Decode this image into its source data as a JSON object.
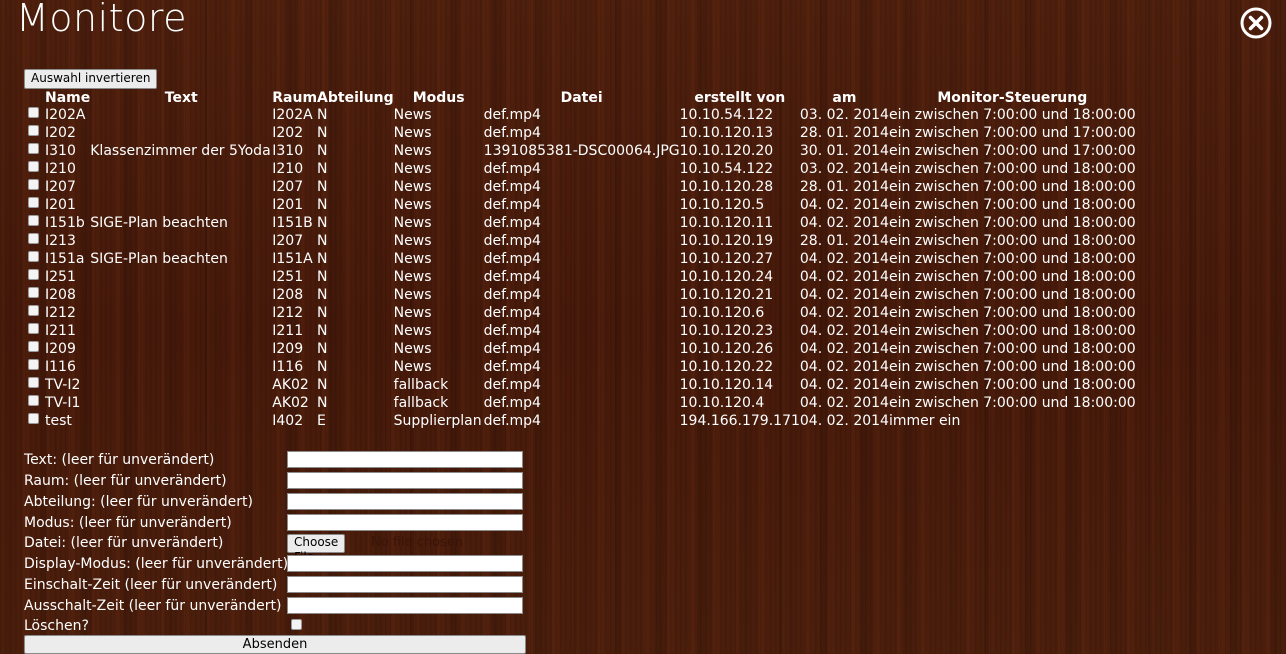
{
  "title": "Monitore",
  "close_icon": "close-circle-icon",
  "invert_button": "Auswahl invertieren",
  "columns": [
    "Name",
    "Text",
    "Raum",
    "Abteilung",
    "Modus",
    "Datei",
    "erstellt von",
    "am",
    "Monitor-Steuerung"
  ],
  "rows": [
    {
      "name": "I202A",
      "text": "",
      "raum": "I202A",
      "abteilung": "N",
      "modus": "News",
      "datei": "def.mp4",
      "ersteller": "10.10.54.122",
      "am": "03. 02. 2014",
      "steuerung": "ein zwischen 7:00:00 und 18:00:00"
    },
    {
      "name": "I202",
      "text": "",
      "raum": "I202",
      "abteilung": "N",
      "modus": "News",
      "datei": "def.mp4",
      "ersteller": "10.10.120.13",
      "am": "28. 01. 2014",
      "steuerung": "ein zwischen 7:00:00 und 17:00:00"
    },
    {
      "name": "I310",
      "text": "Klassenzimmer der 5Yoda",
      "raum": "I310",
      "abteilung": "N",
      "modus": "News",
      "datei": "1391085381-DSC00064.JPG",
      "ersteller": "10.10.120.20",
      "am": "30. 01. 2014",
      "steuerung": "ein zwischen 7:00:00 und 17:00:00"
    },
    {
      "name": "I210",
      "text": "",
      "raum": "I210",
      "abteilung": "N",
      "modus": "News",
      "datei": "def.mp4",
      "ersteller": "10.10.54.122",
      "am": "03. 02. 2014",
      "steuerung": "ein zwischen 7:00:00 und 18:00:00"
    },
    {
      "name": "I207",
      "text": "",
      "raum": "I207",
      "abteilung": "N",
      "modus": "News",
      "datei": "def.mp4",
      "ersteller": "10.10.120.28",
      "am": "28. 01. 2014",
      "steuerung": "ein zwischen 7:00:00 und 18:00:00"
    },
    {
      "name": "I201",
      "text": "",
      "raum": "I201",
      "abteilung": "N",
      "modus": "News",
      "datei": "def.mp4",
      "ersteller": "10.10.120.5",
      "am": "04. 02. 2014",
      "steuerung": "ein zwischen 7:00:00 und 18:00:00"
    },
    {
      "name": "I151b",
      "text": "SIGE-Plan beachten",
      "raum": "I151B",
      "abteilung": "N",
      "modus": "News",
      "datei": "def.mp4",
      "ersteller": "10.10.120.11",
      "am": "04. 02. 2014",
      "steuerung": "ein zwischen 7:00:00 und 18:00:00"
    },
    {
      "name": "I213",
      "text": "",
      "raum": "I207",
      "abteilung": "N",
      "modus": "News",
      "datei": "def.mp4",
      "ersteller": "10.10.120.19",
      "am": "28. 01. 2014",
      "steuerung": "ein zwischen 7:00:00 und 18:00:00"
    },
    {
      "name": "I151a",
      "text": "SIGE-Plan beachten",
      "raum": "I151A",
      "abteilung": "N",
      "modus": "News",
      "datei": "def.mp4",
      "ersteller": "10.10.120.27",
      "am": "04. 02. 2014",
      "steuerung": "ein zwischen 7:00:00 und 18:00:00"
    },
    {
      "name": "I251",
      "text": "",
      "raum": "I251",
      "abteilung": "N",
      "modus": "News",
      "datei": "def.mp4",
      "ersteller": "10.10.120.24",
      "am": "04. 02. 2014",
      "steuerung": "ein zwischen 7:00:00 und 18:00:00"
    },
    {
      "name": "I208",
      "text": "",
      "raum": "I208",
      "abteilung": "N",
      "modus": "News",
      "datei": "def.mp4",
      "ersteller": "10.10.120.21",
      "am": "04. 02. 2014",
      "steuerung": "ein zwischen 7:00:00 und 18:00:00"
    },
    {
      "name": "I212",
      "text": "",
      "raum": "I212",
      "abteilung": "N",
      "modus": "News",
      "datei": "def.mp4",
      "ersteller": "10.10.120.6",
      "am": "04. 02. 2014",
      "steuerung": "ein zwischen 7:00:00 und 18:00:00"
    },
    {
      "name": "I211",
      "text": "",
      "raum": "I211",
      "abteilung": "N",
      "modus": "News",
      "datei": "def.mp4",
      "ersteller": "10.10.120.23",
      "am": "04. 02. 2014",
      "steuerung": "ein zwischen 7:00:00 und 18:00:00"
    },
    {
      "name": "I209",
      "text": "",
      "raum": "I209",
      "abteilung": "N",
      "modus": "News",
      "datei": "def.mp4",
      "ersteller": "10.10.120.26",
      "am": "04. 02. 2014",
      "steuerung": "ein zwischen 7:00:00 und 18:00:00"
    },
    {
      "name": "I116",
      "text": "",
      "raum": "I116",
      "abteilung": "N",
      "modus": "News",
      "datei": "def.mp4",
      "ersteller": "10.10.120.22",
      "am": "04. 02. 2014",
      "steuerung": "ein zwischen 7:00:00 und 18:00:00"
    },
    {
      "name": "TV-I2",
      "text": "",
      "raum": "AK02",
      "abteilung": "N",
      "modus": "fallback",
      "datei": "def.mp4",
      "ersteller": "10.10.120.14",
      "am": "04. 02. 2014",
      "steuerung": "ein zwischen 7:00:00 und 18:00:00"
    },
    {
      "name": "TV-I1",
      "text": "",
      "raum": "AK02",
      "abteilung": "N",
      "modus": "fallback",
      "datei": "def.mp4",
      "ersteller": "10.10.120.4",
      "am": "04. 02. 2014",
      "steuerung": "ein zwischen 7:00:00 und 18:00:00"
    },
    {
      "name": "test",
      "text": "",
      "raum": "I402",
      "abteilung": "E",
      "modus": "Supplierplan",
      "datei": "def.mp4",
      "ersteller": "194.166.179.171",
      "am": "04. 02. 2014",
      "steuerung": "immer ein"
    }
  ],
  "form": {
    "text_label": "Text: (leer für unverändert)",
    "raum_label": "Raum: (leer für unverändert)",
    "abteilung_label": "Abteilung: (leer für unverändert)",
    "modus_label": "Modus: (leer für unverändert)",
    "datei_label": "Datei: (leer für unverändert)",
    "choose_file": "Choose File",
    "no_file": "No file chosen",
    "display_modus_label": "Display-Modus: (leer für unverändert)",
    "einschalt_label": "Einschalt-Zeit (leer für unverändert)",
    "ausschalt_label": "Ausschalt-Zeit (leer für unverändert)",
    "loeschen_label": "Löschen?",
    "submit": "Absenden"
  }
}
